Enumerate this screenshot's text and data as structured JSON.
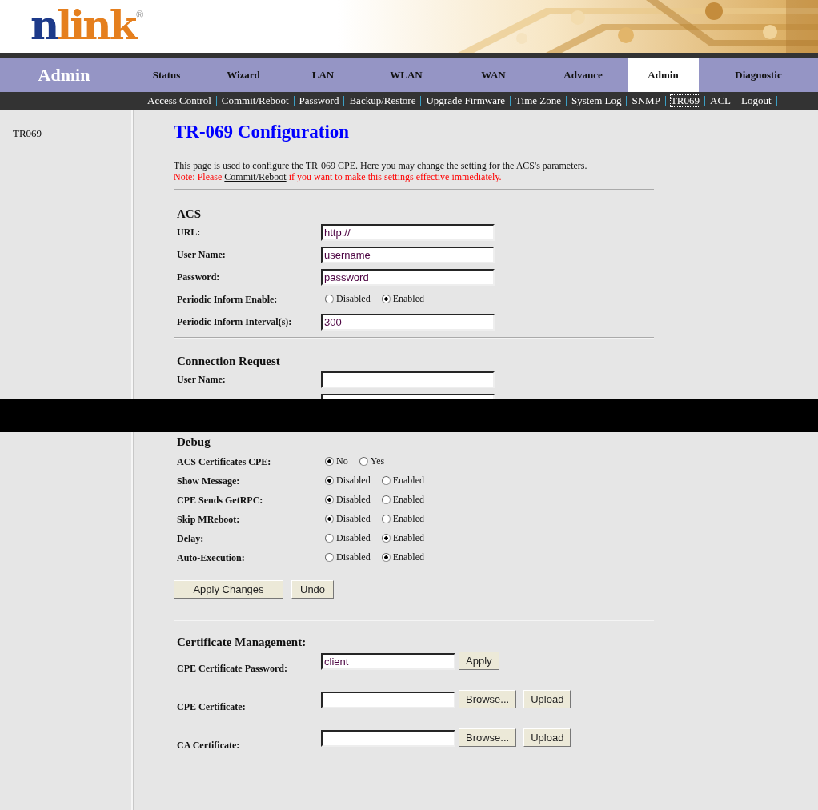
{
  "logo": {
    "lead": "n",
    "rest": "link",
    "mark": "®"
  },
  "banner": {
    "kind": "picture"
  },
  "nav": {
    "section_title": "Admin",
    "tabs": [
      {
        "label": "Status",
        "selected": false
      },
      {
        "label": "Wizard",
        "selected": false
      },
      {
        "label": "LAN",
        "selected": false
      },
      {
        "label": "WLAN",
        "selected": false
      },
      {
        "label": "WAN",
        "selected": false
      },
      {
        "label": "Advance",
        "selected": false
      },
      {
        "label": "Admin",
        "selected": true
      },
      {
        "label": "Diagnostic",
        "selected": false
      }
    ]
  },
  "subnav": [
    {
      "label": "Access Control",
      "selected": false
    },
    {
      "label": "Commit/Reboot",
      "selected": false
    },
    {
      "label": "Password",
      "selected": false
    },
    {
      "label": "Backup/Restore",
      "selected": false
    },
    {
      "label": "Upgrade Firmware",
      "selected": false
    },
    {
      "label": "Time Zone",
      "selected": false
    },
    {
      "label": "System Log",
      "selected": false
    },
    {
      "label": "SNMP",
      "selected": false
    },
    {
      "label": "TR069",
      "selected": true
    },
    {
      "label": "ACL",
      "selected": false
    },
    {
      "label": "Logout",
      "selected": false
    }
  ],
  "sidebar": {
    "items": [
      {
        "label": "TR069"
      }
    ]
  },
  "page": {
    "title": "TR-069 Configuration",
    "description": "This page is used to configure the TR-069 CPE. Here you may change the setting for the ACS's parameters.",
    "note": {
      "before": "Note: Please ",
      "link": "Commit/Reboot",
      "after": " if you want to make this settings effective immediately."
    }
  },
  "acs": {
    "heading": "ACS",
    "rows": [
      {
        "kind": "text",
        "label": "URL:",
        "value": "http://"
      },
      {
        "kind": "text",
        "label": "User Name:",
        "value": "username"
      },
      {
        "kind": "text",
        "label": "Password:",
        "value": "password"
      },
      {
        "kind": "radio",
        "label": "Periodic Inform Enable:",
        "options": [
          {
            "label": "Disabled",
            "selected": false
          },
          {
            "label": "Enabled",
            "selected": true
          }
        ]
      },
      {
        "kind": "text",
        "label": "Periodic Inform Interval(s):",
        "value": "300"
      }
    ]
  },
  "connection_request": {
    "heading": "Connection Request",
    "rows": [
      {
        "kind": "text",
        "label": "User Name:"
      },
      {
        "kind": "text"
      }
    ]
  },
  "redaction_band": true,
  "debug": {
    "heading": "Debug",
    "rows": [
      {
        "kind": "radio",
        "label": "ACS Certificates CPE:",
        "options": [
          {
            "label": "No",
            "selected": true
          },
          {
            "label": "Yes",
            "selected": false
          }
        ]
      },
      {
        "kind": "radio",
        "label": "Show Message:",
        "options": [
          {
            "label": "Disabled",
            "selected": true
          },
          {
            "label": "Enabled",
            "selected": false
          }
        ]
      },
      {
        "kind": "radio",
        "label": "CPE Sends GetRPC:",
        "options": [
          {
            "label": "Disabled",
            "selected": true
          },
          {
            "label": "Enabled",
            "selected": false
          }
        ]
      },
      {
        "kind": "radio",
        "label": "Skip MReboot:",
        "options": [
          {
            "label": "Disabled",
            "selected": true
          },
          {
            "label": "Enabled",
            "selected": false
          }
        ]
      },
      {
        "kind": "radio",
        "label": "Delay:",
        "options": [
          {
            "label": "Disabled",
            "selected": false
          },
          {
            "label": "Enabled",
            "selected": true
          }
        ]
      },
      {
        "kind": "radio",
        "label": "Auto-Execution:",
        "options": [
          {
            "label": "Disabled",
            "selected": false
          },
          {
            "label": "Enabled",
            "selected": true
          }
        ]
      }
    ]
  },
  "buttons": [
    "Apply Changes",
    "Undo"
  ],
  "certificates": {
    "heading": "Certificate Management:",
    "rows": [
      {
        "kind": "password",
        "label": "CPE Certificate Password:",
        "value": "client",
        "buttons": [
          "Apply"
        ]
      },
      {
        "kind": "file",
        "label": "CPE Certificate:",
        "buttons": [
          "Browse...",
          "Upload"
        ]
      },
      {
        "kind": "file",
        "label": "CA Certificate:",
        "buttons": [
          "Browse...",
          "Upload"
        ]
      }
    ]
  }
}
